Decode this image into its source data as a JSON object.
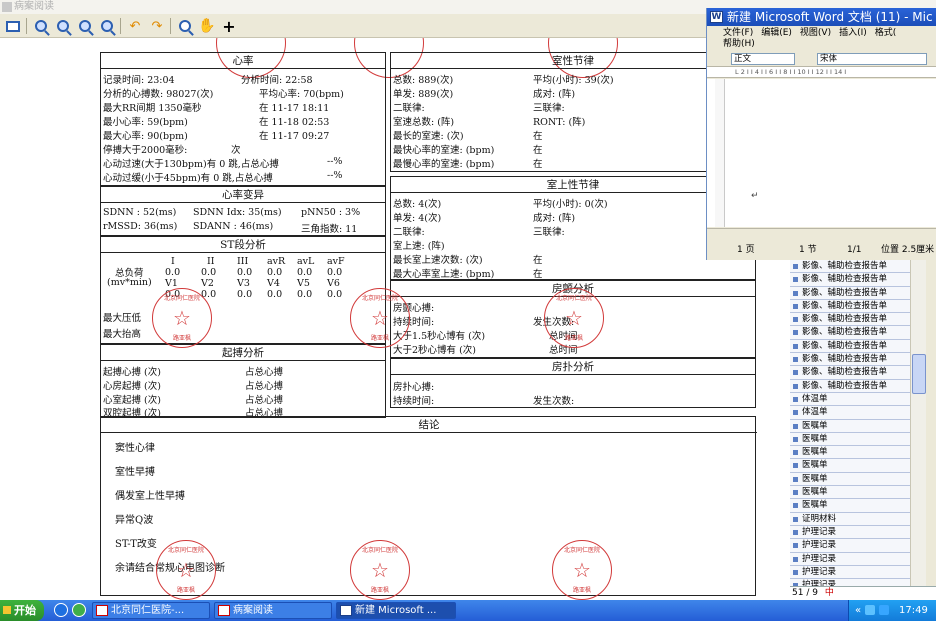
{
  "app": {
    "title": "病案阅读"
  },
  "toolbar": {
    "add_label": "+"
  },
  "report": {
    "hr": {
      "title": "心率",
      "lines": [
        "记录时间: 23:04",
        "分析时间: 22:58",
        "分析的心搏数: 98027(次)",
        "平均心率: 70(bpm)",
        "最大RR间期 1350毫秒",
        "在 11-17 18:11",
        "最小心率:  59(bpm)",
        "在 11-18 02:53",
        "最大心率:  90(bpm)",
        "在 11-17 09:27",
        "停搏大于2000毫秒:",
        "次",
        "心动过速(大于130bpm)有  0 跳,占总心搏",
        "--%",
        "心动过缓(小于45bpm)有  0 跳,占总心搏",
        "--%"
      ]
    },
    "hrv": {
      "title": "心率变异",
      "lines": [
        "SDNN : 52(ms)",
        "SDNN Idx: 35(ms)",
        "pNN50  : 3%",
        "rMSSD: 36(ms)",
        "SDANN : 46(ms)",
        "三角指数: 11"
      ]
    },
    "st": {
      "title": "ST段分析",
      "label1": "总负荷",
      "label2": "(mv*min)",
      "headers1": [
        "I",
        "II",
        "III",
        "avR",
        "avL",
        "avF"
      ],
      "row1": [
        "0.0",
        "0.0",
        "0.0",
        "0.0",
        "0.0",
        "0.0"
      ],
      "headers2": [
        "V1",
        "V2",
        "V3",
        "V4",
        "V5",
        "V6"
      ],
      "row2": [
        "0.0",
        "0.0",
        "0.0",
        "0.0",
        "0.0",
        "0.0"
      ]
    },
    "bp": {
      "lines": [
        "最大压低",
        "最大抬高"
      ]
    },
    "pacing": {
      "title": "起搏分析",
      "lines": [
        "起搏心搏  (次)",
        "占总心搏",
        "心房起搏  (次)",
        "占总心搏",
        "心室起搏  (次)",
        "占总心搏",
        "双腔起搏  (次)",
        "占总心搏"
      ]
    },
    "ventricular": {
      "title": "室性节律",
      "lines": [
        "总数:  889(次)",
        "平均(小时): 39(次)",
        "单发:  889(次)",
        "成对:   (阵)",
        "二联律:",
        "三联律:",
        "室速总数:  (阵)",
        "RONT:      (阵)",
        "最长的室速:  (次)",
        "在",
        "最快心率的室速:  (bpm)",
        "在",
        "最慢心率的室速:  (bpm)",
        "在"
      ]
    },
    "supraventricular": {
      "title": "室上性节律",
      "lines": [
        "总数:   4(次)",
        "平均(小时): 0(次)",
        "单发:   4(次)",
        "成对:   (阵)",
        "二联律:",
        "三联律:",
        "室上速:   (阵)",
        "",
        "最长室上速次数:  (次)",
        "在",
        "最大心率室上速:  (bpm)",
        "在"
      ]
    },
    "af": {
      "title": "房颤分析",
      "lines": [
        "房颤心搏:",
        "持续时间:",
        "发生次数:",
        "大于1.5秒心博有  (次)",
        "总时间",
        "大于2秒心博有  (次)",
        "总时间"
      ]
    },
    "aflutter": {
      "title": "房扑分析",
      "lines": [
        "房扑心搏:",
        "持续时间:",
        "发生次数:"
      ]
    },
    "conclusion": {
      "title": "结论",
      "items": [
        "窦性心律",
        "室性早搏",
        "偶发室上性早搏",
        "异常Q波",
        "ST-T改变",
        "余请结合常规心电图诊断"
      ]
    },
    "stamp_text": "北京同仁医院",
    "stamp_sub": "路亚枫"
  },
  "word": {
    "title": "新建 Microsoft Word 文档 (11) - Mic",
    "icon_letter": "W",
    "menu": [
      "文件(F)",
      "编辑(E)",
      "视图(V)",
      "插入(I)",
      "格式(",
      "帮助(H)"
    ],
    "style_combo": "正文",
    "font_combo": "宋体",
    "ruler": "L    2 I  I 4 I  I 6 I  I 8 I  I 10 I  I 12 I  I 14 I",
    "cursor_mark": "↵",
    "status": {
      "page": "1 页",
      "section": "1 节",
      "pages": "1/1",
      "position": "位置 2.5厘米"
    }
  },
  "list_panel": {
    "items": [
      "影像、辅助检查报告单",
      "影像、辅助检查报告单",
      "影像、辅助检查报告单",
      "影像、辅助检查报告单",
      "影像、辅助检查报告单",
      "影像、辅助检查报告单",
      "影像、辅助检查报告单",
      "影像、辅助检查报告单",
      "影像、辅助检查报告单",
      "影像、辅助检查报告单",
      "体温单",
      "体温单",
      "医嘱单",
      "医嘱单",
      "医嘱单",
      "医嘱单",
      "医嘱单",
      "医嘱单",
      "医嘱单",
      "证明材料",
      "护理记录",
      "护理记录",
      "护理记录",
      "护理记录",
      "护理记录"
    ],
    "ime_text": "51 / 9",
    "ime_mode": "中"
  },
  "taskbar": {
    "start": "开始",
    "buttons": [
      "北京同仁医院-...",
      "病案阅读",
      "新建 Microsoft ..."
    ],
    "time": "17:49"
  }
}
